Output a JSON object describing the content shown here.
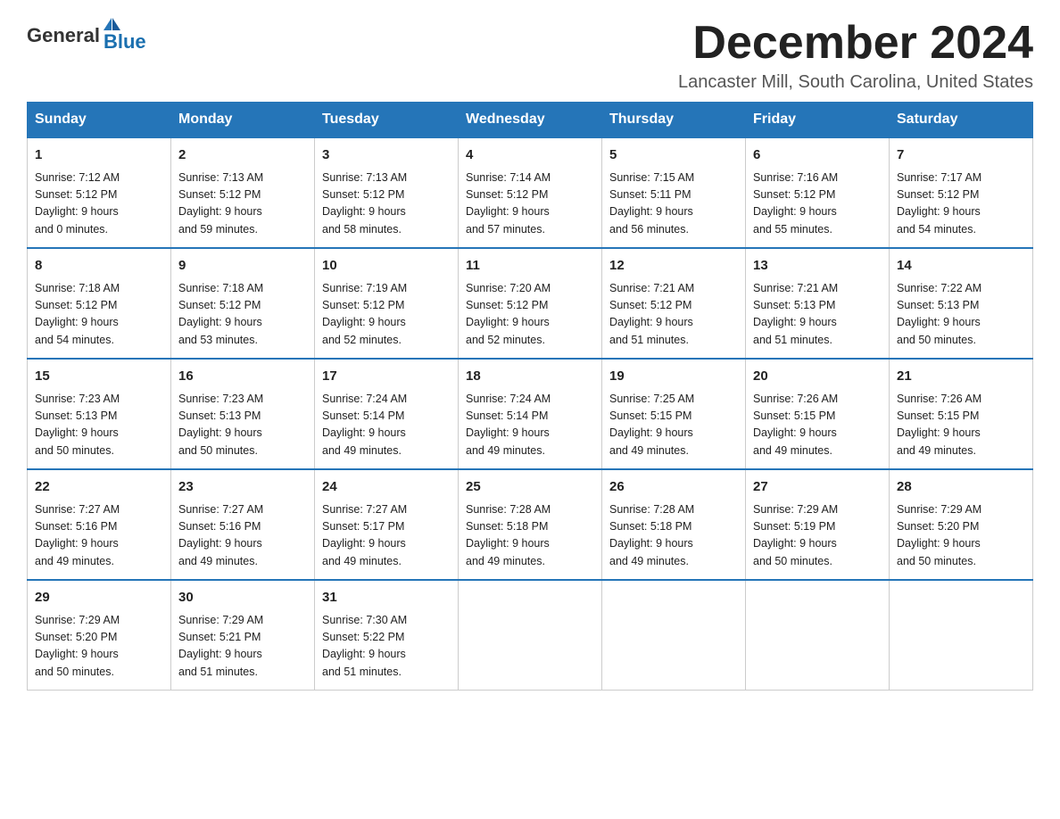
{
  "header": {
    "logo": {
      "general": "General",
      "blue": "Blue"
    },
    "month_title": "December 2024",
    "location": "Lancaster Mill, South Carolina, United States"
  },
  "days_of_week": [
    "Sunday",
    "Monday",
    "Tuesday",
    "Wednesday",
    "Thursday",
    "Friday",
    "Saturday"
  ],
  "weeks": [
    [
      {
        "day": "1",
        "sunrise": "7:12 AM",
        "sunset": "5:12 PM",
        "daylight": "9 hours and 0 minutes."
      },
      {
        "day": "2",
        "sunrise": "7:13 AM",
        "sunset": "5:12 PM",
        "daylight": "9 hours and 59 minutes."
      },
      {
        "day": "3",
        "sunrise": "7:13 AM",
        "sunset": "5:12 PM",
        "daylight": "9 hours and 58 minutes."
      },
      {
        "day": "4",
        "sunrise": "7:14 AM",
        "sunset": "5:12 PM",
        "daylight": "9 hours and 57 minutes."
      },
      {
        "day": "5",
        "sunrise": "7:15 AM",
        "sunset": "5:11 PM",
        "daylight": "9 hours and 56 minutes."
      },
      {
        "day": "6",
        "sunrise": "7:16 AM",
        "sunset": "5:12 PM",
        "daylight": "9 hours and 55 minutes."
      },
      {
        "day": "7",
        "sunrise": "7:17 AM",
        "sunset": "5:12 PM",
        "daylight": "9 hours and 54 minutes."
      }
    ],
    [
      {
        "day": "8",
        "sunrise": "7:18 AM",
        "sunset": "5:12 PM",
        "daylight": "9 hours and 54 minutes."
      },
      {
        "day": "9",
        "sunrise": "7:18 AM",
        "sunset": "5:12 PM",
        "daylight": "9 hours and 53 minutes."
      },
      {
        "day": "10",
        "sunrise": "7:19 AM",
        "sunset": "5:12 PM",
        "daylight": "9 hours and 52 minutes."
      },
      {
        "day": "11",
        "sunrise": "7:20 AM",
        "sunset": "5:12 PM",
        "daylight": "9 hours and 52 minutes."
      },
      {
        "day": "12",
        "sunrise": "7:21 AM",
        "sunset": "5:12 PM",
        "daylight": "9 hours and 51 minutes."
      },
      {
        "day": "13",
        "sunrise": "7:21 AM",
        "sunset": "5:13 PM",
        "daylight": "9 hours and 51 minutes."
      },
      {
        "day": "14",
        "sunrise": "7:22 AM",
        "sunset": "5:13 PM",
        "daylight": "9 hours and 50 minutes."
      }
    ],
    [
      {
        "day": "15",
        "sunrise": "7:23 AM",
        "sunset": "5:13 PM",
        "daylight": "9 hours and 50 minutes."
      },
      {
        "day": "16",
        "sunrise": "7:23 AM",
        "sunset": "5:13 PM",
        "daylight": "9 hours and 50 minutes."
      },
      {
        "day": "17",
        "sunrise": "7:24 AM",
        "sunset": "5:14 PM",
        "daylight": "9 hours and 49 minutes."
      },
      {
        "day": "18",
        "sunrise": "7:24 AM",
        "sunset": "5:14 PM",
        "daylight": "9 hours and 49 minutes."
      },
      {
        "day": "19",
        "sunrise": "7:25 AM",
        "sunset": "5:15 PM",
        "daylight": "9 hours and 49 minutes."
      },
      {
        "day": "20",
        "sunrise": "7:26 AM",
        "sunset": "5:15 PM",
        "daylight": "9 hours and 49 minutes."
      },
      {
        "day": "21",
        "sunrise": "7:26 AM",
        "sunset": "5:15 PM",
        "daylight": "9 hours and 49 minutes."
      }
    ],
    [
      {
        "day": "22",
        "sunrise": "7:27 AM",
        "sunset": "5:16 PM",
        "daylight": "9 hours and 49 minutes."
      },
      {
        "day": "23",
        "sunrise": "7:27 AM",
        "sunset": "5:16 PM",
        "daylight": "9 hours and 49 minutes."
      },
      {
        "day": "24",
        "sunrise": "7:27 AM",
        "sunset": "5:17 PM",
        "daylight": "9 hours and 49 minutes."
      },
      {
        "day": "25",
        "sunrise": "7:28 AM",
        "sunset": "5:18 PM",
        "daylight": "9 hours and 49 minutes."
      },
      {
        "day": "26",
        "sunrise": "7:28 AM",
        "sunset": "5:18 PM",
        "daylight": "9 hours and 49 minutes."
      },
      {
        "day": "27",
        "sunrise": "7:29 AM",
        "sunset": "5:19 PM",
        "daylight": "9 hours and 50 minutes."
      },
      {
        "day": "28",
        "sunrise": "7:29 AM",
        "sunset": "5:20 PM",
        "daylight": "9 hours and 50 minutes."
      }
    ],
    [
      {
        "day": "29",
        "sunrise": "7:29 AM",
        "sunset": "5:20 PM",
        "daylight": "9 hours and 50 minutes."
      },
      {
        "day": "30",
        "sunrise": "7:29 AM",
        "sunset": "5:21 PM",
        "daylight": "9 hours and 51 minutes."
      },
      {
        "day": "31",
        "sunrise": "7:30 AM",
        "sunset": "5:22 PM",
        "daylight": "9 hours and 51 minutes."
      },
      null,
      null,
      null,
      null
    ]
  ],
  "labels": {
    "sunrise": "Sunrise:",
    "sunset": "Sunset:",
    "daylight": "Daylight:"
  }
}
